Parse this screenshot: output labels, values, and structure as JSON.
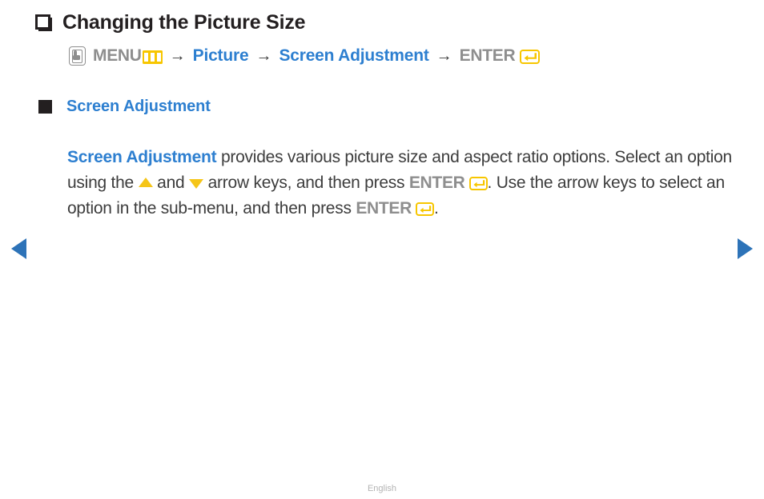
{
  "page": {
    "title": "Changing the Picture Size",
    "title_bullet_icon": "hollow-square-bullet-icon"
  },
  "breadcrumb": {
    "remote_icon": "hand-press-remote-icon",
    "menu_label": "MENU",
    "menu_icon": "menu-bars-icon",
    "arrow_1": "→",
    "picture_label": "Picture",
    "arrow_2": "→",
    "screen_adjustment_label": "Screen Adjustment",
    "arrow_3": "→",
    "enter_label": "ENTER",
    "enter_icon": "enter-return-icon"
  },
  "section": {
    "bullet_icon": "filled-square-bullet-icon",
    "heading": "Screen Adjustment"
  },
  "body": {
    "lead_term": "Screen Adjustment",
    "text_1": " provides various picture size and aspect ratio options. Select an option using the ",
    "up_arrow_icon": "triangle-up-icon",
    "text_2": " and ",
    "down_arrow_icon": "triangle-down-icon",
    "text_3": " arrow keys, and then press ",
    "enter_label_1": "ENTER",
    "enter_icon_1": "enter-return-icon",
    "text_4": ". Use the arrow keys to select an option in the sub-menu, and then press ",
    "enter_label_2": "ENTER",
    "enter_icon_2": "enter-return-icon",
    "text_5": "."
  },
  "navigation": {
    "prev_label": "previous-page-arrow",
    "next_label": "next-page-arrow"
  },
  "footer": {
    "language": "English"
  },
  "colors": {
    "accent_blue": "#2d7fd0",
    "nav_blue": "#2d73b8",
    "accent_yellow": "#f7c600",
    "triangle_yellow": "#f5c518",
    "gray_label": "#8e8e8e",
    "body_text": "#3d3d3d",
    "bullet_dark": "#231f20",
    "footer_gray": "#b3b3b3"
  }
}
